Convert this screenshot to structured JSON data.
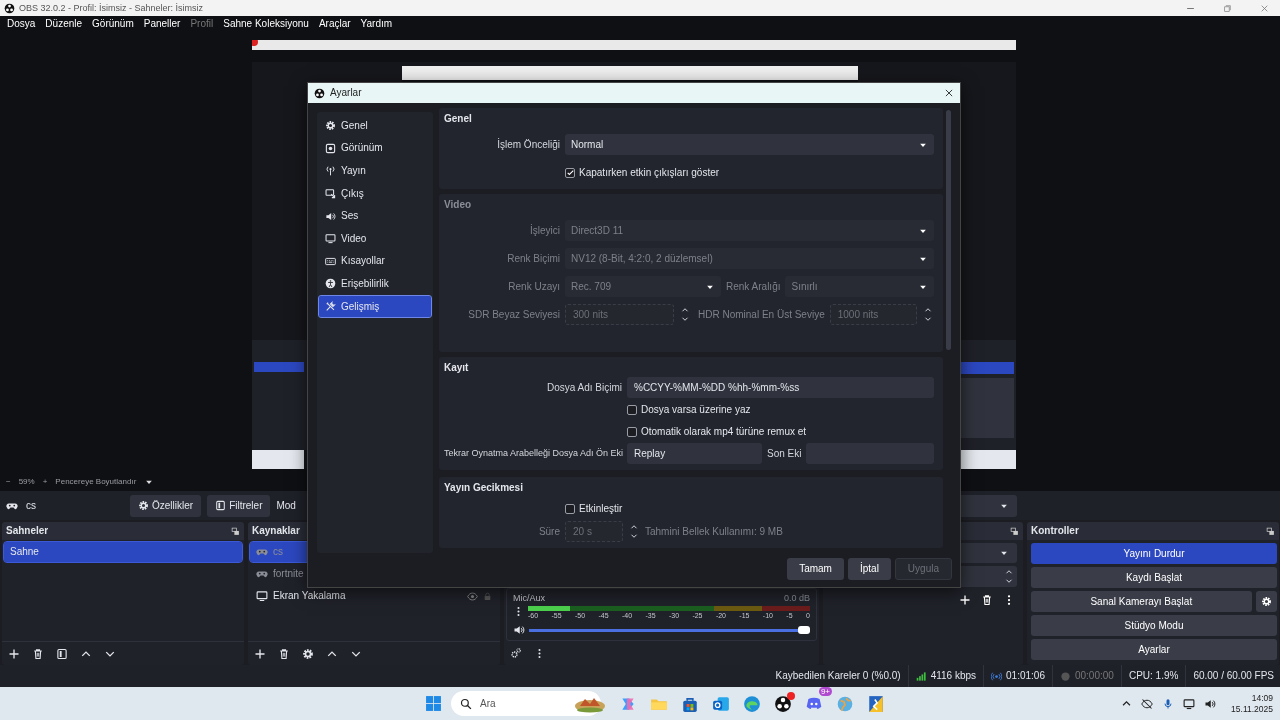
{
  "window": {
    "title": "OBS 32.0.2 - Profil: İsimsiz - Sahneler: İsimsiz"
  },
  "menu": [
    {
      "label": "Dosya",
      "disabled": false
    },
    {
      "label": "Düzenle",
      "disabled": false
    },
    {
      "label": "Görünüm",
      "disabled": false
    },
    {
      "label": "Paneller",
      "disabled": false
    },
    {
      "label": "Profil",
      "disabled": true
    },
    {
      "label": "Sahne Koleksiyonu",
      "disabled": false
    },
    {
      "label": "Araçlar",
      "disabled": false
    },
    {
      "label": "Yardım",
      "disabled": false
    }
  ],
  "zoom_bar": {
    "minus": "−",
    "zoom": "59%",
    "plus": "+",
    "fit": "Pencereye Boyutlandır"
  },
  "source_toolbar": {
    "source": "cs",
    "buttons": [
      {
        "label": "Özellikler",
        "kind": "gear"
      },
      {
        "label": "Filtreler",
        "kind": "filter"
      },
      {
        "label": "Mod",
        "kind": "text"
      }
    ]
  },
  "scenes": {
    "title": "Sahneler",
    "items": [
      {
        "label": "Sahne",
        "selected": true
      }
    ]
  },
  "sources": {
    "title": "Kaynaklar",
    "items": [
      {
        "label": "cs",
        "kind": "game",
        "selected": true,
        "disabled": true
      },
      {
        "label": "fortnite",
        "kind": "game",
        "selected": false,
        "disabled": true
      },
      {
        "label": "Ekran Yakalama",
        "kind": "display",
        "selected": false,
        "disabled": false
      }
    ]
  },
  "mixer": {
    "channels": [
      {
        "name": "Mic/Aux",
        "reading": "0.0 dB",
        "meter": {
          "level": 0.15
        },
        "volume": {
          "level": 1.0
        },
        "scale": [
          "-60",
          "-55",
          "-50",
          "-45",
          "-40",
          "-35",
          "-30",
          "-25",
          "-20",
          "-15",
          "-10",
          "-5",
          "0"
        ]
      }
    ]
  },
  "controls": {
    "title": "Kontroller",
    "buttons": [
      {
        "label": "Yayını Durdur",
        "active": true
      },
      {
        "label": "Kaydı Başlat",
        "active": false
      },
      {
        "label": "Sanal Kamerayı Başlat",
        "active": false
      },
      {
        "label": "Stüdyo Modu",
        "active": false
      },
      {
        "label": "Ayarlar",
        "active": false
      }
    ]
  },
  "status_bar": {
    "dropped": "Kaybedilen Kareler 0 (%0.0)",
    "bitrate": "4116 kbps",
    "stream_time": "01:01:06",
    "record_time": "00:00:00",
    "cpu": "CPU: 1.9%",
    "fps": "60.00 / 60.00 FPS"
  },
  "dialog": {
    "title": "Ayarlar",
    "nav": [
      {
        "label": "Genel",
        "selected": false
      },
      {
        "label": "Görünüm",
        "selected": false
      },
      {
        "label": "Yayın",
        "selected": false
      },
      {
        "label": "Çıkış",
        "selected": false
      },
      {
        "label": "Ses",
        "selected": false
      },
      {
        "label": "Video",
        "selected": false
      },
      {
        "label": "Kısayollar",
        "selected": false
      },
      {
        "label": "Erişebilirlik",
        "selected": false
      },
      {
        "label": "Gelişmiş",
        "selected": true
      }
    ],
    "sections": [
      {
        "title": "Genel",
        "disabled": false,
        "rows": [
          {
            "kind": "select",
            "label": "İşlem Önceliği",
            "value": "Normal",
            "disabled": false
          },
          {
            "kind": "checkbox",
            "text": "Kapatırken etkin çıkışları göster",
            "checked": true
          }
        ]
      },
      {
        "title": "Video",
        "disabled": true,
        "rows": [
          {
            "kind": "select",
            "label": "İşleyici",
            "value": "Direct3D 11",
            "disabled": true
          },
          {
            "kind": "select",
            "label": "Renk Biçimi",
            "value": "NV12 (8-Bit, 4:2:0, 2 düzlemsel)",
            "disabled": true
          },
          {
            "kind": "select_pair",
            "label": "Renk Uzayı",
            "value": "Rec. 709",
            "label2": "Renk Aralığı",
            "value2": "Sınırlı",
            "disabled": true
          },
          {
            "kind": "spin_pair",
            "label": "SDR Beyaz Seviyesi",
            "value": "300 nits",
            "label2": "HDR Nominal En Üst Seviye",
            "value2": "1000 nits",
            "disabled": true
          }
        ]
      },
      {
        "title": "Kayıt",
        "disabled": false,
        "rows": [
          {
            "kind": "text",
            "label": "Dosya Adı Biçimi",
            "value": "%CCYY-%MM-%DD %hh-%mm-%ss"
          },
          {
            "kind": "checkbox",
            "text": "Dosya varsa üzerine yaz",
            "checked": false
          },
          {
            "kind": "checkbox",
            "text": "Otomatik olarak mp4 türüne remux et",
            "checked": false
          },
          {
            "kind": "text_pair",
            "label": "Tekrar Oynatma Arabelleği Dosya Adı Ön Eki",
            "value": "Replay",
            "label2": "Son Eki"
          }
        ]
      },
      {
        "title": "Yayın Gecikmesi",
        "disabled": false,
        "rows": [
          {
            "kind": "checkbox",
            "text": "Etkinleştir",
            "checked": false
          },
          {
            "kind": "spin_note",
            "label": "Süre",
            "value": "20 s",
            "note": "Tahmini Bellek Kullanımı: 9 MB",
            "disabled": true
          }
        ]
      }
    ],
    "buttons": [
      {
        "label": "Tamam",
        "disabled": false
      },
      {
        "label": "İptal",
        "disabled": false
      },
      {
        "label": "Uygula",
        "disabled": true
      }
    ]
  },
  "taskbar": {
    "search": "Ara",
    "badge": "9+",
    "time": "14:09",
    "date": "15.11.2025"
  }
}
